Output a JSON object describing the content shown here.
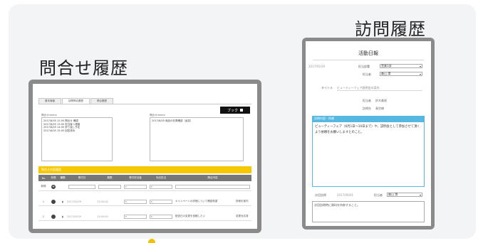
{
  "titles": {
    "left": "問合せ履歴",
    "right": "訪問履歴"
  },
  "colors": {
    "accent_yellow": "#f5c800",
    "accent_blue": "#56b7e0",
    "frame": "#8a8a8a",
    "background_card": "#f3f4f6"
  },
  "left_screen": {
    "tabs": [
      "基本情報",
      "訪問問合履歴",
      "問合履歴"
    ],
    "book_button": "ブック",
    "memo1_label": "問合せmemo",
    "memo1_lines": [
      "2017/8/05 12:00 問合せ 確認",
      "2017/8/05 13:00 担当者へ連絡",
      "2017/8/05 14:00 折り返し予定",
      "2017/8/05 15:00 回答済み"
    ],
    "memo2_label": "問合せmemo",
    "memo2_lines": [
      "2017/8/05 商品の在庫確認（返答）"
    ],
    "yellow_bar": "問合せ内容履歴",
    "headers": [
      "No",
      "状態",
      "種類",
      "受付日",
      "期限",
      "受付担当者",
      "対応担当",
      "問合内容"
    ],
    "rows": [
      {
        "no": "新規",
        "date": "",
        "time": "",
        "text": ""
      },
      {
        "no": "1",
        "date": "2017/05/29",
        "time": "13:00:00",
        "text": "キャンペーンの詳細について確認希望",
        "note": "詳細を案内"
      },
      {
        "no": "2",
        "date": "2017/05/29",
        "time": "13:00:00",
        "text": "配送日の変更を依頼したい",
        "note": "変更対応済"
      }
    ]
  },
  "right_screen": {
    "title": "活動日報",
    "date": "2017/05/29",
    "fields": [
      {
        "label": "担当部署",
        "value": "営業1部"
      },
      {
        "label": "担当者",
        "value": "森山 潤"
      }
    ],
    "subject_label": "タイトル",
    "subject_value": "ビューティーフェア説明会の案内",
    "person_rows": [
      {
        "label": "担当者",
        "value": "鈴木美咲"
      },
      {
        "label": "訪問先",
        "value": "青空様"
      }
    ],
    "section_label": "訪問内容・所感",
    "body": "ビューティーフェア（6月1日〜10日まで）や、説明会として参加させて頂くよう依頼をお願いしますとのこと。",
    "footer_fields": [
      {
        "label": "次回訪問",
        "value": "2017/06/01"
      },
      {
        "label": "担当者",
        "value": "森山 潤"
      }
    ],
    "footer_note": "次回訪問時に資料を持参すること。"
  }
}
